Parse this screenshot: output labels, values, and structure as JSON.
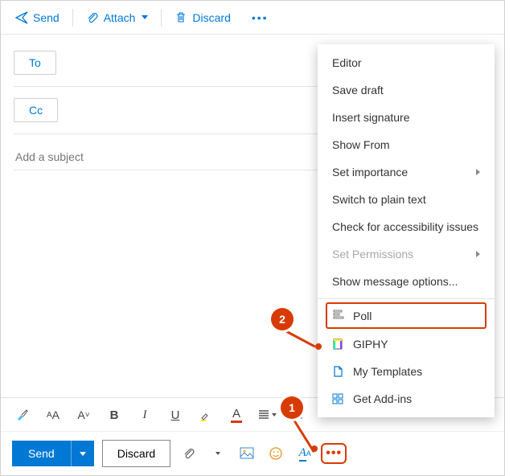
{
  "topbar": {
    "send": "Send",
    "attach": "Attach",
    "discard": "Discard"
  },
  "fields": {
    "to": "To",
    "cc": "Cc",
    "subject_placeholder": "Add a subject"
  },
  "format": {
    "bold": "B",
    "italic": "I",
    "underline": "U",
    "font_letter": "A"
  },
  "bottom": {
    "send": "Send",
    "discard": "Discard"
  },
  "menu": {
    "items": [
      {
        "label": "Editor",
        "submenu": false,
        "disabled": false
      },
      {
        "label": "Save draft",
        "submenu": false,
        "disabled": false
      },
      {
        "label": "Insert signature",
        "submenu": false,
        "disabled": false
      },
      {
        "label": "Show From",
        "submenu": false,
        "disabled": false
      },
      {
        "label": "Set importance",
        "submenu": true,
        "disabled": false
      },
      {
        "label": "Switch to plain text",
        "submenu": false,
        "disabled": false
      },
      {
        "label": "Check for accessibility issues",
        "submenu": false,
        "disabled": false
      },
      {
        "label": "Set Permissions",
        "submenu": true,
        "disabled": true
      },
      {
        "label": "Show message options...",
        "submenu": false,
        "disabled": false
      }
    ],
    "poll": "Poll",
    "addons": [
      {
        "label": "GIPHY"
      },
      {
        "label": "My Templates"
      },
      {
        "label": "Get Add-ins"
      }
    ]
  },
  "callouts": {
    "one": "1",
    "two": "2"
  }
}
